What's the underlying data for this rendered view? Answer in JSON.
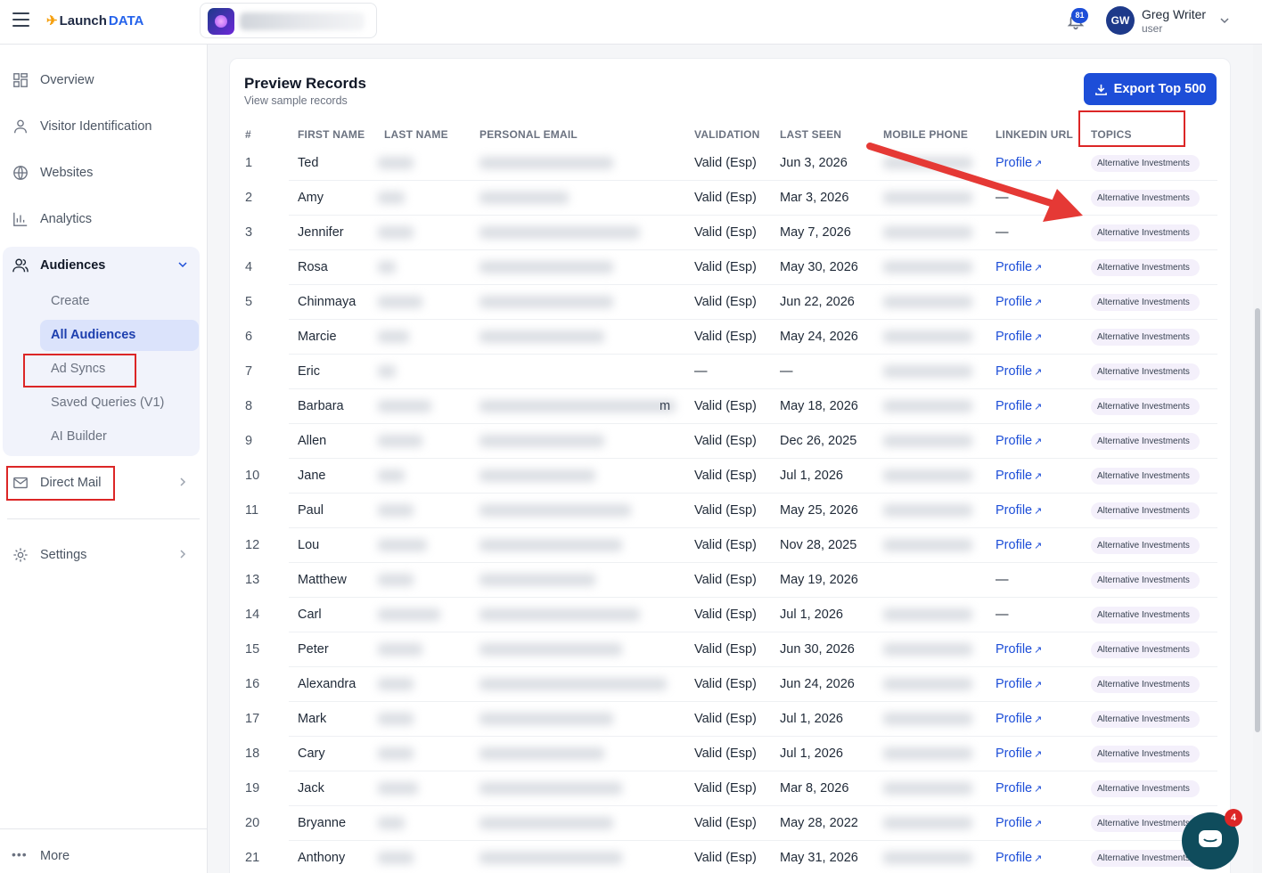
{
  "app": {
    "logo_text": "Launch",
    "logo_accent": "DATA"
  },
  "header": {
    "notifications_count": "81",
    "user_initials": "GW",
    "user_name": "Greg Writer",
    "user_role": "user"
  },
  "sidebar": {
    "items": [
      {
        "label": "Overview"
      },
      {
        "label": "Visitor Identification"
      },
      {
        "label": "Websites"
      },
      {
        "label": "Analytics"
      },
      {
        "label": "Audiences"
      },
      {
        "label": "Direct Mail"
      },
      {
        "label": "Settings"
      }
    ],
    "audience_sub": [
      {
        "label": "Create"
      },
      {
        "label": "All Audiences"
      },
      {
        "label": "Ad Syncs"
      },
      {
        "label": "Saved Queries (V1)"
      },
      {
        "label": "AI Builder"
      }
    ],
    "more_label": "More"
  },
  "preview": {
    "title": "Preview Records",
    "subtitle": "View sample records",
    "export_label": "Export Top 500",
    "columns": [
      "#",
      "FIRST NAME",
      "LAST NAME",
      "PERSONAL EMAIL",
      "VALIDATION",
      "LAST SEEN",
      "MOBILE PHONE",
      "LINKEDIN URL",
      "TOPICS"
    ],
    "profile_label": "Profile",
    "topic_label": "Alternative Investments",
    "rows": [
      {
        "n": "1",
        "first": "Ted",
        "validation": "Valid (Esp)",
        "seen": "Jun 3, 2026",
        "linkedin": "Profile"
      },
      {
        "n": "2",
        "first": "Amy",
        "validation": "Valid (Esp)",
        "seen": "Mar 3, 2026",
        "linkedin": "—"
      },
      {
        "n": "3",
        "first": "Jennifer",
        "validation": "Valid (Esp)",
        "seen": "May 7, 2026",
        "linkedin": "—"
      },
      {
        "n": "4",
        "first": "Rosa",
        "validation": "Valid (Esp)",
        "seen": "May 30, 2026",
        "linkedin": "Profile"
      },
      {
        "n": "5",
        "first": "Chinmaya",
        "validation": "Valid (Esp)",
        "seen": "Jun 22, 2026",
        "linkedin": "Profile"
      },
      {
        "n": "6",
        "first": "Marcie",
        "validation": "Valid (Esp)",
        "seen": "May 24, 2026",
        "linkedin": "Profile"
      },
      {
        "n": "7",
        "first": "Eric",
        "validation": "—",
        "seen": "—",
        "linkedin": "Profile"
      },
      {
        "n": "8",
        "first": "Barbara",
        "validation": "Valid (Esp)",
        "seen": "May 18, 2026",
        "linkedin": "Profile",
        "email_tail": "m"
      },
      {
        "n": "9",
        "first": "Allen",
        "validation": "Valid (Esp)",
        "seen": "Dec 26, 2025",
        "linkedin": "Profile"
      },
      {
        "n": "10",
        "first": "Jane",
        "validation": "Valid (Esp)",
        "seen": "Jul 1, 2026",
        "linkedin": "Profile"
      },
      {
        "n": "11",
        "first": "Paul",
        "validation": "Valid (Esp)",
        "seen": "May 25, 2026",
        "linkedin": "Profile"
      },
      {
        "n": "12",
        "first": "Lou",
        "validation": "Valid (Esp)",
        "seen": "Nov 28, 2025",
        "linkedin": "Profile"
      },
      {
        "n": "13",
        "first": "Matthew",
        "validation": "Valid (Esp)",
        "seen": "May 19, 2026",
        "linkedin": "—"
      },
      {
        "n": "14",
        "first": "Carl",
        "validation": "Valid (Esp)",
        "seen": "Jul 1, 2026",
        "linkedin": "—"
      },
      {
        "n": "15",
        "first": "Peter",
        "validation": "Valid (Esp)",
        "seen": "Jun 30, 2026",
        "linkedin": "Profile"
      },
      {
        "n": "16",
        "first": "Alexandra",
        "validation": "Valid (Esp)",
        "seen": "Jun 24, 2026",
        "linkedin": "Profile"
      },
      {
        "n": "17",
        "first": "Mark",
        "validation": "Valid (Esp)",
        "seen": "Jul 1, 2026",
        "linkedin": "Profile"
      },
      {
        "n": "18",
        "first": "Cary",
        "validation": "Valid (Esp)",
        "seen": "Jul 1, 2026",
        "linkedin": "Profile"
      },
      {
        "n": "19",
        "first": "Jack",
        "validation": "Valid (Esp)",
        "seen": "Mar 8, 2026",
        "linkedin": "Profile"
      },
      {
        "n": "20",
        "first": "Bryanne",
        "validation": "Valid (Esp)",
        "seen": "May 28, 2022",
        "linkedin": "Profile"
      },
      {
        "n": "21",
        "first": "Anthony",
        "validation": "Valid (Esp)",
        "seen": "May 31, 2026",
        "linkedin": "Profile"
      }
    ]
  },
  "chat": {
    "badge_count": "4"
  },
  "colors": {
    "accent": "#1d4ed8",
    "highlight_box": "#dc2626",
    "arrow": "#e53935"
  },
  "icons": [
    "menu-icon",
    "bell-icon",
    "grid-icon",
    "user-icon",
    "globe-icon",
    "bar-chart-icon",
    "users-icon",
    "mail-icon",
    "gear-icon",
    "download-icon",
    "external-link-icon",
    "chat-icon"
  ]
}
